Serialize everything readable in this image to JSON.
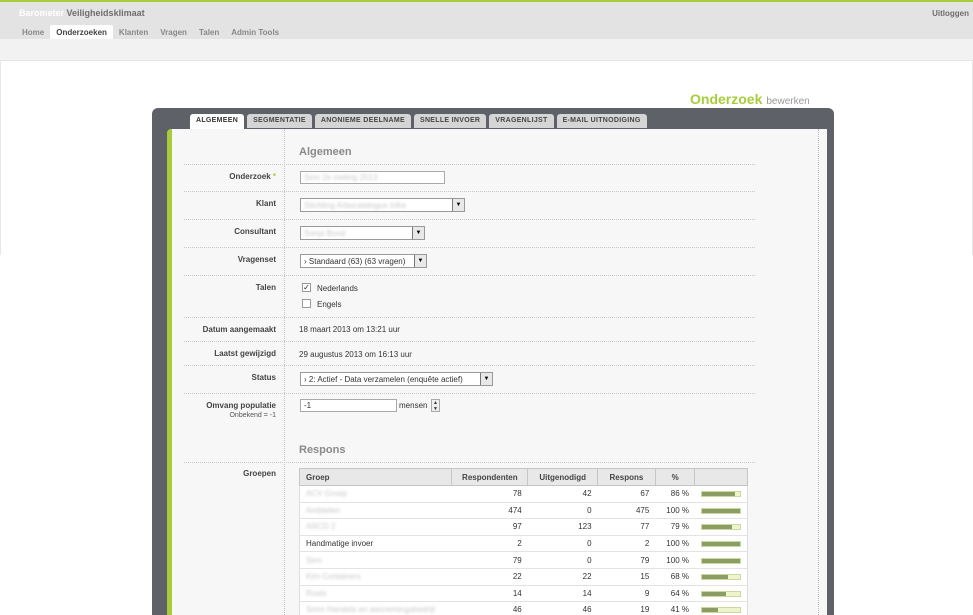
{
  "app": {
    "brand_part1": "Barometer",
    "brand_part2": "Veiligheidsklimaat",
    "logout": "Uitloggen"
  },
  "nav": [
    "Home",
    "Onderzoeken",
    "Klanten",
    "Vragen",
    "Talen",
    "Admin Tools"
  ],
  "page": {
    "title": "Onderzoek",
    "subtitle": "bewerken"
  },
  "tabs": [
    "ALGEMEEN",
    "SEGMENTATIE",
    "ANONIEME DEELNAME",
    "SNELLE INVOER",
    "VRAGENLIJST",
    "E-MAIL UITNODIGING"
  ],
  "form": {
    "section_general": "Algemeen",
    "onderzoek_label": "Onderzoek",
    "required_mark": "*",
    "onderzoek_value": "Sinn 2e meting 2013",
    "klant_label": "Klant",
    "klant_value": "Stichting Arbocatalogus Infra",
    "consultant_label": "Consultant",
    "consultant_value": "Sonja Bond",
    "vragenset_label": "Vragenset",
    "vragenset_value": "› Standaard (63) (63 vragen)",
    "talen_label": "Talen",
    "lang_nl": "Nederlands",
    "lang_en": "Engels",
    "created_label": "Datum aangemaakt",
    "created_value": "18 maart 2013 om 13:21 uur",
    "modified_label": "Laatst gewijzigd",
    "modified_value": "29 augustus 2013 om 16:13 uur",
    "status_label": "Status",
    "status_value": "› 2: Actief - Data verzamelen (enquête actief)",
    "population_label": "Omvang populatie",
    "population_hint": "Onbekend = -1",
    "population_value": "-1",
    "population_unit": "mensen",
    "section_response": "Respons",
    "groups_label": "Groepen"
  },
  "table": {
    "headers": [
      "Groep",
      "Respondenten",
      "Uitgenodigd",
      "Respons",
      "%"
    ],
    "rows": [
      {
        "group": "ACV Groep",
        "resp": "78",
        "inv": "42",
        "rsp": "67",
        "pct": "86 %",
        "ratio": 0.86
      },
      {
        "group": "Ambtelen",
        "resp": "474",
        "inv": "0",
        "rsp": "475",
        "pct": "100 %",
        "ratio": 1.0
      },
      {
        "group": "ARCD 2",
        "resp": "97",
        "inv": "123",
        "rsp": "77",
        "pct": "79 %",
        "ratio": 0.79
      },
      {
        "group": "Handmatige invoer",
        "resp": "2",
        "inv": "0",
        "rsp": "2",
        "pct": "100 %",
        "ratio": 1.0
      },
      {
        "group": "Sinn",
        "resp": "79",
        "inv": "0",
        "rsp": "79",
        "pct": "100 %",
        "ratio": 1.0
      },
      {
        "group": "Kim Containers",
        "resp": "22",
        "inv": "22",
        "rsp": "15",
        "pct": "68 %",
        "ratio": 0.68
      },
      {
        "group": "Roels",
        "resp": "14",
        "inv": "14",
        "rsp": "9",
        "pct": "64 %",
        "ratio": 0.64
      },
      {
        "group": "Smm Handels en aannemingsbedrijf",
        "resp": "46",
        "inv": "46",
        "rsp": "19",
        "pct": "41 %",
        "ratio": 0.41
      }
    ]
  },
  "colors": {
    "accent": "#a9cd3a",
    "panel": "#5f6168",
    "bar_fill": "#8b9d63"
  }
}
